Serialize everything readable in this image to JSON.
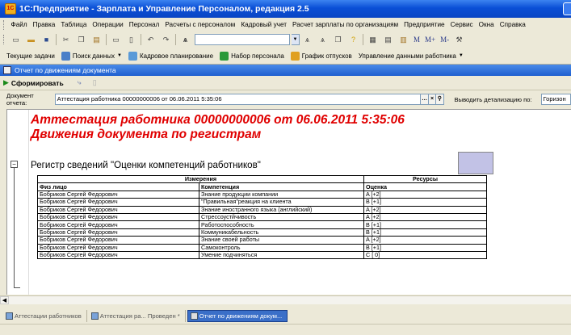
{
  "window": {
    "title": "1С:Предприятие - Зарплата и Управление Персоналом, редакция 2.5",
    "app_icon_text": "1С"
  },
  "menu": [
    "Файл",
    "Правка",
    "Таблица",
    "Операции",
    "Персонал",
    "Расчеты с персоналом",
    "Кадровый учет",
    "Расчет зарплаты по организациям",
    "Предприятие",
    "Сервис",
    "Окна",
    "Справка"
  ],
  "toolbar1": {
    "icons": [
      "new-icon",
      "open-icon",
      "save-icon",
      "cut-icon",
      "copy-icon",
      "paste-icon",
      "print-icon",
      "preview-icon",
      "undo-icon",
      "redo-icon",
      "find-icon"
    ],
    "search_value": "",
    "font_labels": [
      "M",
      "M+",
      "M-"
    ]
  },
  "toolbar2": [
    {
      "label": "Текущие задачи",
      "icon": "tasks-icon",
      "color": "#e8e4d0"
    },
    {
      "label": "Поиск данных",
      "icon": "search-data-icon",
      "color": "#4a7fc8"
    },
    {
      "label": "Кадровое планирование",
      "icon": "planning-icon",
      "color": "#5a9ad8"
    },
    {
      "label": "Набор персонала",
      "icon": "recruit-icon",
      "color": "#2a9a3a"
    },
    {
      "label": "График отпусков",
      "icon": "vacation-icon",
      "color": "#e0a020"
    },
    {
      "label": "Управление данными работника",
      "icon": "worker-data-icon",
      "color": "#e8e4d0"
    }
  ],
  "document_window": {
    "title": "Отчет по движениям документа",
    "generate_label": "Сформировать"
  },
  "params": {
    "doc_label": "Документ отчета:",
    "doc_value": "Аттестация работника 00000000006 от 06.06.2011 5:35:06",
    "detail_label": "Выводить детализацию по:",
    "detail_value": "Горизон"
  },
  "report": {
    "heading1": "Аттестация работника 00000000006 от 06.06.2011 5:35:06",
    "heading2": "Движения документа по регистрам",
    "register_title": "Регистр сведений \"Оценки компетенций работников\"",
    "group_headers": {
      "measures": "Измерения",
      "resources": "Ресурсы"
    },
    "columns": {
      "person": "Физ лицо",
      "competence": "Компетенция",
      "grade": "Оценка"
    },
    "rows": [
      [
        "Бобриков Сергей Федорович",
        "Знание продукции компании",
        "A [+2]"
      ],
      [
        "Бобриков Сергей Федорович",
        "\"Правильная\"реакция на клиента",
        "B [+1]"
      ],
      [
        "Бобриков Сергей Федорович",
        "Знание иностранного языка (английский)",
        "A [+2]"
      ],
      [
        "Бобриков Сергей Федорович",
        "Стрессоустйчивость",
        "A [+2]"
      ],
      [
        "Бобриков Сергей Федорович",
        "Работоспособность",
        "B [+1]"
      ],
      [
        "Бобриков Сергей Федорович",
        "Коммуникабельность",
        "B [+1]"
      ],
      [
        "Бобриков Сергей Федорович",
        "Знание своей работы",
        "A [+2]"
      ],
      [
        "Бобриков Сергей Федорович",
        "Самоконтроль",
        "B [+1]"
      ],
      [
        "Бобриков Сергей Федорович",
        "Умение подчиняться",
        "C [ 0]"
      ]
    ]
  },
  "taskbar_tabs": [
    {
      "label": "Аттестации работников",
      "active": false
    },
    {
      "label": "Аттестация ра... Проведен *",
      "active": false
    },
    {
      "label": "Отчет по движениям докум...",
      "active": true
    }
  ]
}
